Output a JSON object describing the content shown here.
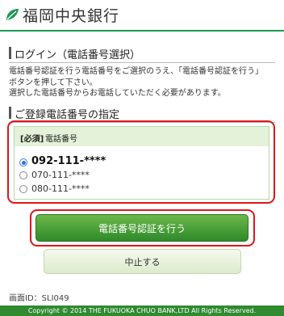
{
  "header": {
    "logo_icon": "leaf-logo-icon",
    "brand": "福岡中央銀行",
    "accent": "#1a9a55"
  },
  "login": {
    "title": "ログイン（電話番号選択）",
    "description": [
      "電話番号認証を行う電話番号をご選択のうえ、「電話番号認証を行う」",
      "ボタンを押して下さい。",
      "選択した電話番号からお電話していただく必要があります。"
    ]
  },
  "registered": {
    "title": "ご登録電話番号の指定",
    "required_badge": "[必須]",
    "field_label": "電話番号",
    "options": [
      {
        "number": "092-111-****",
        "selected": true
      },
      {
        "number": "070-111-****",
        "selected": false
      },
      {
        "number": "080-111-****",
        "selected": false
      }
    ]
  },
  "buttons": {
    "verify": "電話番号認証を行う",
    "cancel": "中止する"
  },
  "screen_id": "画面ID：SLI049",
  "footer": {
    "copyright": "Copyright © 2014 THE FUKUOKA CHUO BANK,LTD All Rights Reserved."
  },
  "colors": {
    "primary_button": "#3f9a36",
    "highlight_border": "#e0151a",
    "footer_bg": "#2f8a30"
  }
}
